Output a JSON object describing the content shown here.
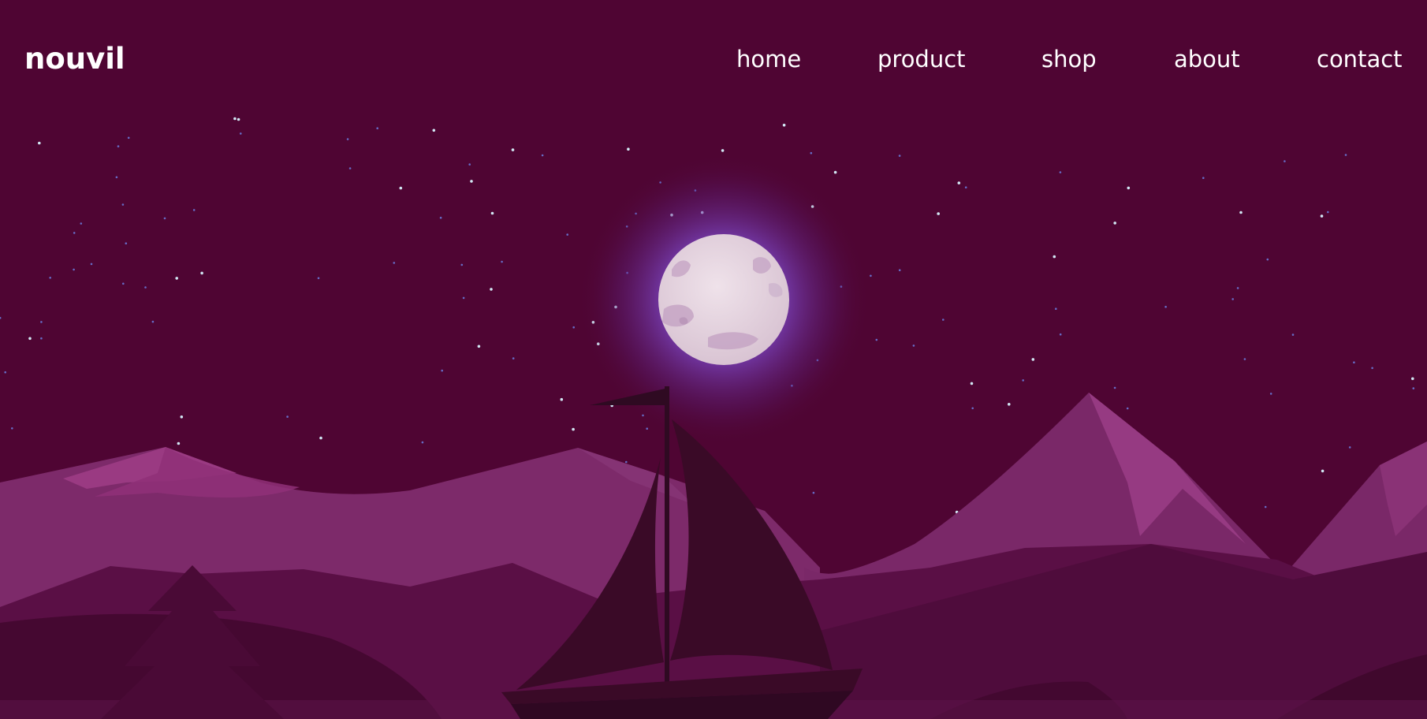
{
  "site": {
    "logo": "nouvil"
  },
  "nav": {
    "items": [
      {
        "label": "home"
      },
      {
        "label": "product"
      },
      {
        "label": "shop"
      },
      {
        "label": "about"
      },
      {
        "label": "contact"
      }
    ]
  },
  "colors": {
    "background": "#4f0533",
    "text": "#ffffff",
    "moon_glow": "#8b5fd6",
    "moon": "#e6d6e2",
    "mountain_light": "#7d2a6a",
    "mountain_dark": "#5a0f45",
    "boat": "#3a0a27"
  },
  "icons": {
    "moon": "moon-icon",
    "boat": "sailboat-icon",
    "tree": "pine-tree-icon"
  }
}
